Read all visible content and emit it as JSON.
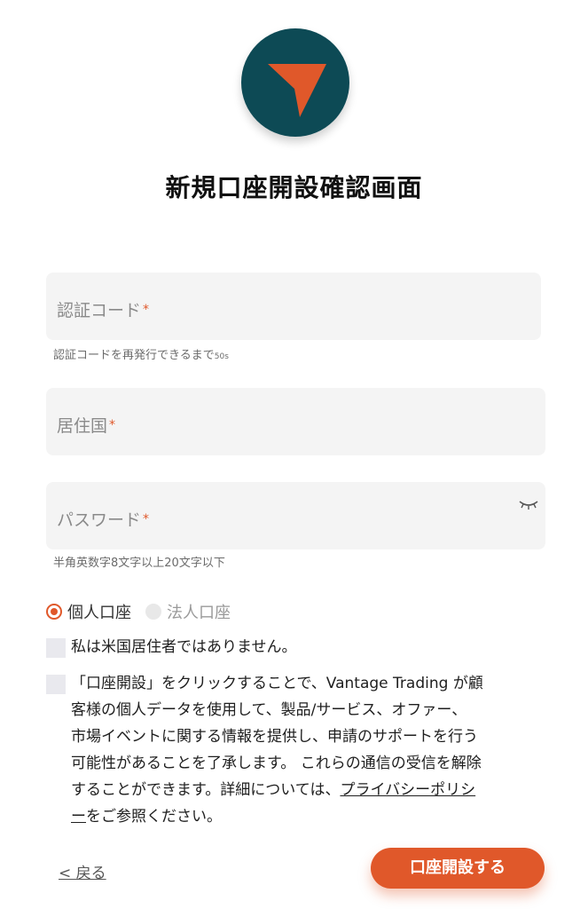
{
  "header": {
    "title": "新規口座開設確認画面"
  },
  "form": {
    "code": {
      "placeholder": "認証コード",
      "required_mark": "*",
      "hint_prefix": "認証コードを再発行できるまで",
      "hint_count": "50s"
    },
    "country": {
      "placeholder": "居住国",
      "required_mark": "*"
    },
    "password": {
      "placeholder": "パスワード",
      "required_mark": "*",
      "hint": "半角英数字8文字以上20文字以下"
    },
    "account_type": {
      "options": [
        {
          "label": "個人口座",
          "selected": true
        },
        {
          "label": "法人口座",
          "selected": false
        }
      ]
    },
    "us_resident_label": "私は米国居住者ではありません。",
    "consent": {
      "line1": "「口座開設」をクリックすることで、Vantage Trading が顧",
      "line2": "客様の個人データを使用して、製品/サービス、オファー、",
      "line3": "市場イベントに関する情報を提供し、申請のサポートを行う",
      "line4": "可能性があることを了承します。 これらの通信の受信を解除",
      "line5_text": "することができます。詳細については、",
      "link_part1": "プライバシーポリシ",
      "link_part2": "ー",
      "line6_text": "をご参照ください。"
    }
  },
  "actions": {
    "back_label": "< 戻る",
    "submit_label": "口座開設する"
  },
  "colors": {
    "accent": "#e0582a",
    "logo_bg": "#0d4a55",
    "field_bg": "#f4f4f4"
  },
  "icons": [
    "logo-arrow-icon",
    "eye-closed-icon"
  ]
}
